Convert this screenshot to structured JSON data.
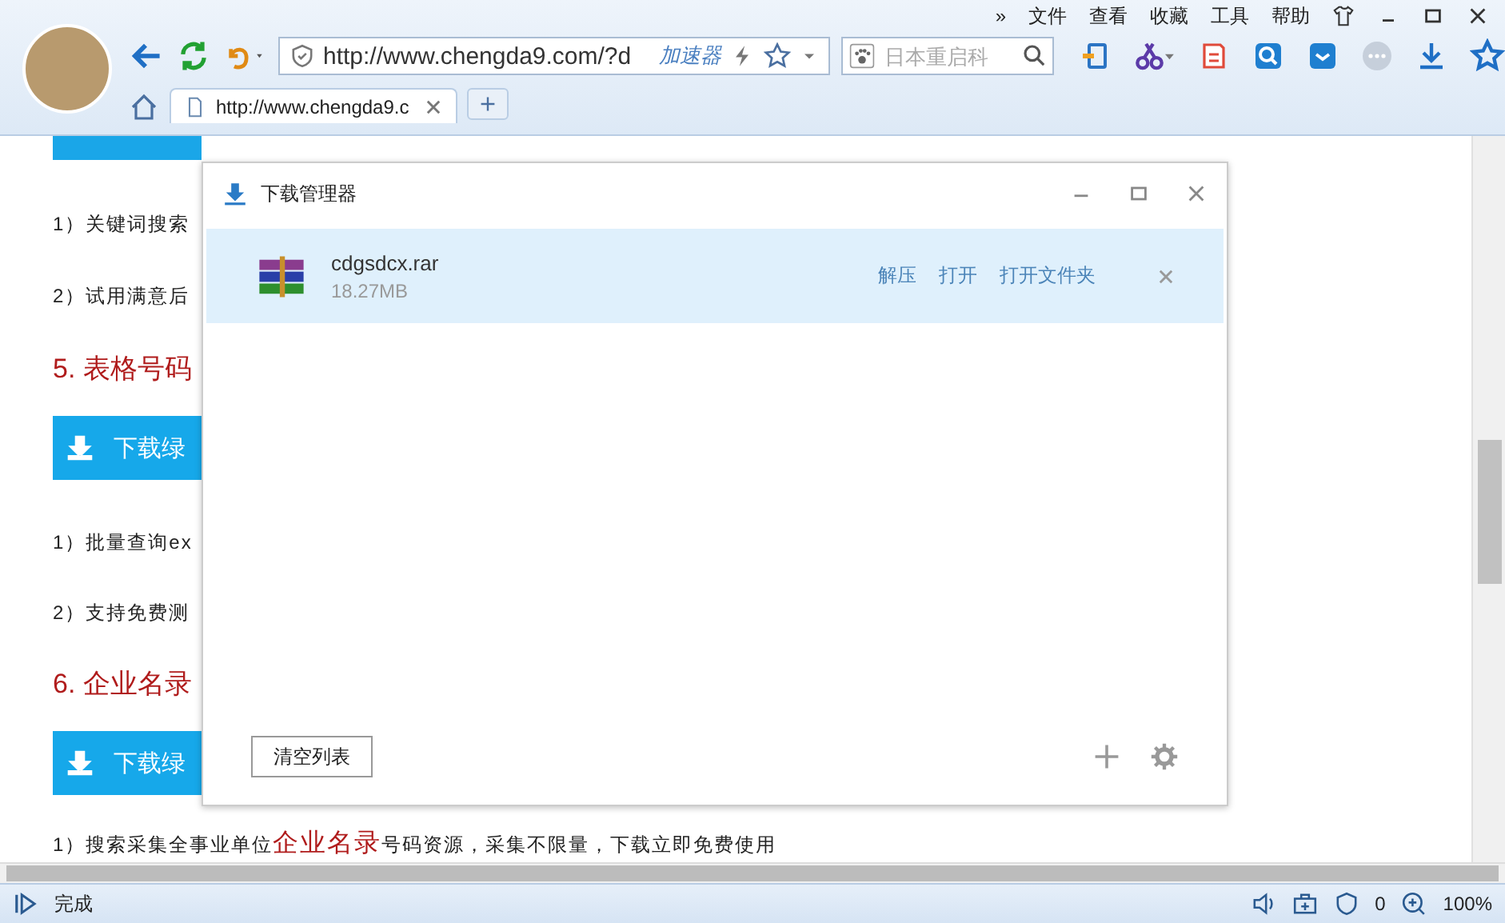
{
  "browser": {
    "menu": [
      "»",
      "文件",
      "查看",
      "收藏",
      "工具",
      "帮助"
    ],
    "address": {
      "value": "http://www.chengda9.com/?d",
      "accelerator": "加速器"
    },
    "search": {
      "placeholder": "日本重启科"
    },
    "tabs": [
      {
        "label": "http://www.chengda9.c",
        "selected": true
      }
    ],
    "status": {
      "text": "完成",
      "ad_count": "0",
      "zoom": "100%"
    }
  },
  "page": {
    "items": [
      {
        "kind": "button_top"
      },
      {
        "kind": "text",
        "text": "1）关键词搜索"
      },
      {
        "kind": "text",
        "text": "2）试用满意后"
      },
      {
        "kind": "heading",
        "text": "5. 表格号码"
      },
      {
        "kind": "button",
        "text": "下载绿"
      },
      {
        "kind": "text",
        "text": "1）批量查询ex"
      },
      {
        "kind": "text",
        "text": "2）支持免费测"
      },
      {
        "kind": "heading",
        "text": "6. 企业名录"
      },
      {
        "kind": "button",
        "text": "下载绿"
      },
      {
        "kind": "rich",
        "text": "1）搜索采集全事业单位**企业名录**号码资源，采集不限量，下载立即免费使用"
      }
    ]
  },
  "dialog": {
    "title": "下载管理器",
    "downloads": [
      {
        "name": "cdgsdcx.rar",
        "size": "18.27MB",
        "selected": true,
        "actions": [
          "解压",
          "打开",
          "打开文件夹"
        ]
      }
    ],
    "clear_button": "清空列表"
  }
}
